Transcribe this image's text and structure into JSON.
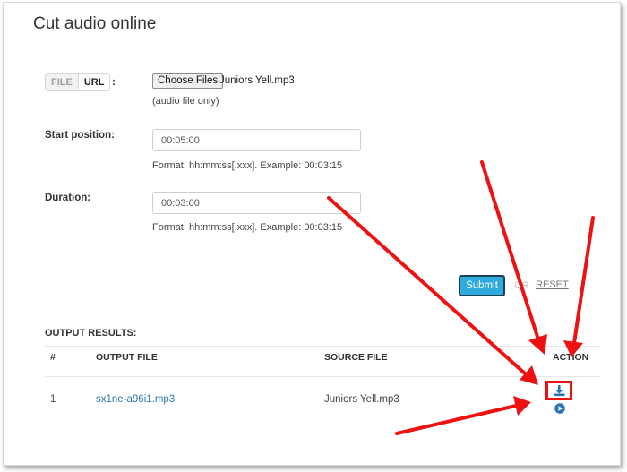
{
  "page": {
    "title": "Cut audio online"
  },
  "source": {
    "tabs": [
      {
        "label": "FILE"
      },
      {
        "label": "URL"
      }
    ],
    "colon": ":",
    "choose_label": "Choose Files",
    "file_name": "Juniors Yell.mp3",
    "hint": "(audio file only)"
  },
  "start": {
    "label": "Start position:",
    "value": "00:05:00",
    "format": "Format: hh:mm:ss[.xxx]. Example: 00:03:15"
  },
  "duration": {
    "label": "Duration:",
    "value": "00:03:00",
    "format": "Format: hh:mm:ss[.xxx]. Example: 00:03:15"
  },
  "actions": {
    "submit_label": "Submit",
    "or_label": "OR",
    "reset_label": "RESET"
  },
  "results": {
    "title": "OUTPUT RESULTS:",
    "columns": [
      "#",
      "OUTPUT FILE",
      "SOURCE FILE",
      "ACTION"
    ],
    "rows": [
      {
        "index": "1",
        "output": "sx1ne-a96i1.mp3",
        "source": "Juniors Yell.mp3",
        "actions": [
          "download-icon",
          "play-icon"
        ]
      }
    ]
  },
  "colors": {
    "accent": "#2eaadc",
    "link": "#2a76b4",
    "annotation": "#ee1111"
  }
}
